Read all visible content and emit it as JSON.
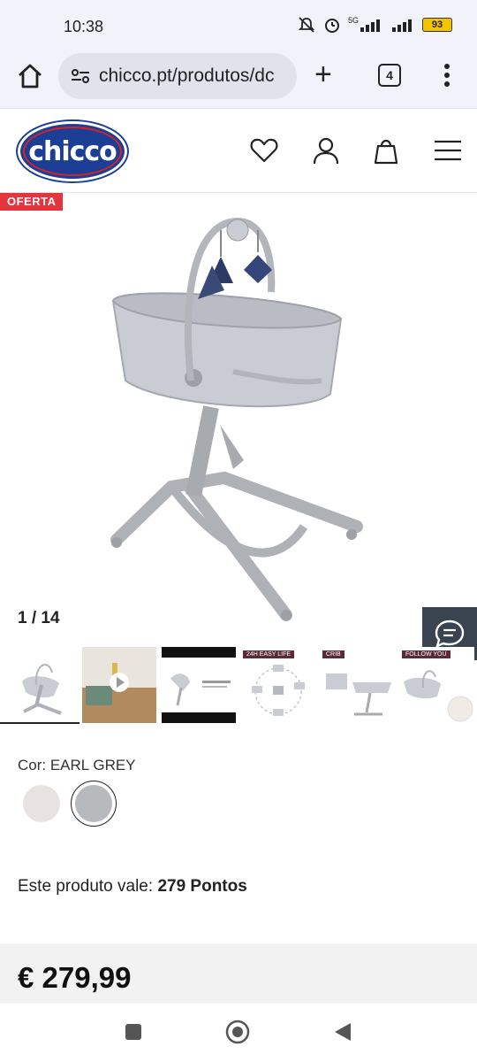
{
  "status_bar": {
    "time": "10:38",
    "network": "5G",
    "battery": "93"
  },
  "browser": {
    "url": "chicco.pt/produtos/dc",
    "tab_count": "4"
  },
  "header": {
    "brand": "chicco"
  },
  "product": {
    "badge": "OFERTA",
    "image_counter": "1 / 14",
    "thumbnails": [
      {
        "label": ""
      },
      {
        "label": ""
      },
      {
        "label": ""
      },
      {
        "label": "24H EASY LIFE"
      },
      {
        "label": "CRIB"
      },
      {
        "label": "FOLLOW YOU"
      }
    ],
    "color_label": "Cor: EARL GREY",
    "swatches": [
      {
        "name": "cream",
        "color": "#e8e3e0"
      },
      {
        "name": "earl grey",
        "color": "#b7babd",
        "selected": true
      }
    ],
    "points_prefix": "Este produto vale:",
    "points_value": "279 Pontos",
    "price": "€ 279,99"
  },
  "colors": {
    "offer": "#e4353f",
    "brand": "#1c3f95",
    "brand_red": "#d3232c"
  }
}
